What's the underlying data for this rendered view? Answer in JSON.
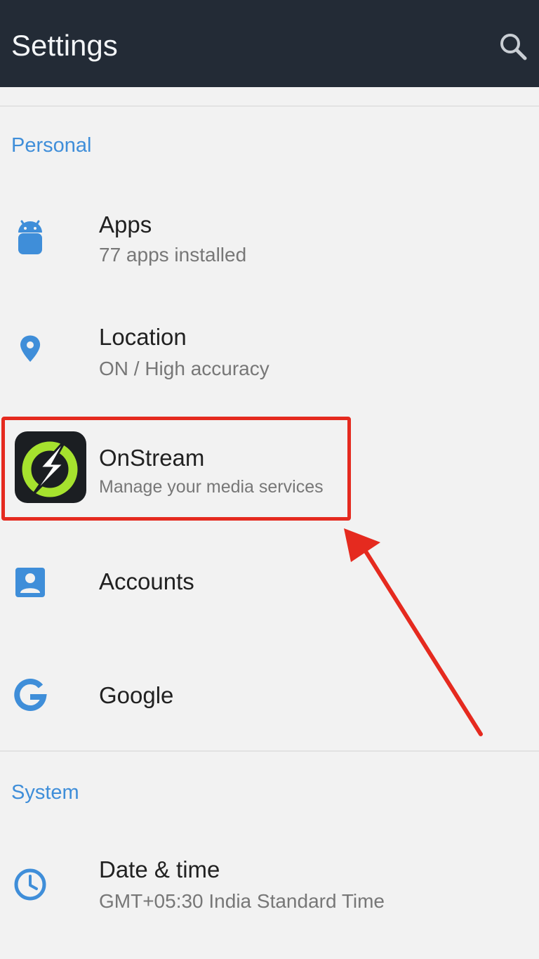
{
  "appbar": {
    "title": "Settings"
  },
  "sections": {
    "personal": "Personal",
    "system": "System"
  },
  "items": {
    "apps": {
      "title": "Apps",
      "subtitle": "77 apps installed"
    },
    "location": {
      "title": "Location",
      "subtitle": "ON / High accuracy"
    },
    "onstream": {
      "title": "OnStream",
      "subtitle": "Manage your media services"
    },
    "accounts": {
      "title": "Accounts"
    },
    "google": {
      "title": "Google"
    },
    "datetime": {
      "title": "Date & time",
      "subtitle": "GMT+05:30 India Standard Time"
    }
  },
  "icons": {
    "search": "search-icon",
    "apps": "android-icon",
    "location": "location-pin-icon",
    "onstream": "onstream-app-icon",
    "accounts": "account-icon",
    "google": "google-g-icon",
    "datetime": "clock-icon"
  },
  "colors": {
    "appbar": "#232b36",
    "accent": "#3f8ed9",
    "highlight": "#e52a1f",
    "onstream_green": "#a6e22e"
  }
}
